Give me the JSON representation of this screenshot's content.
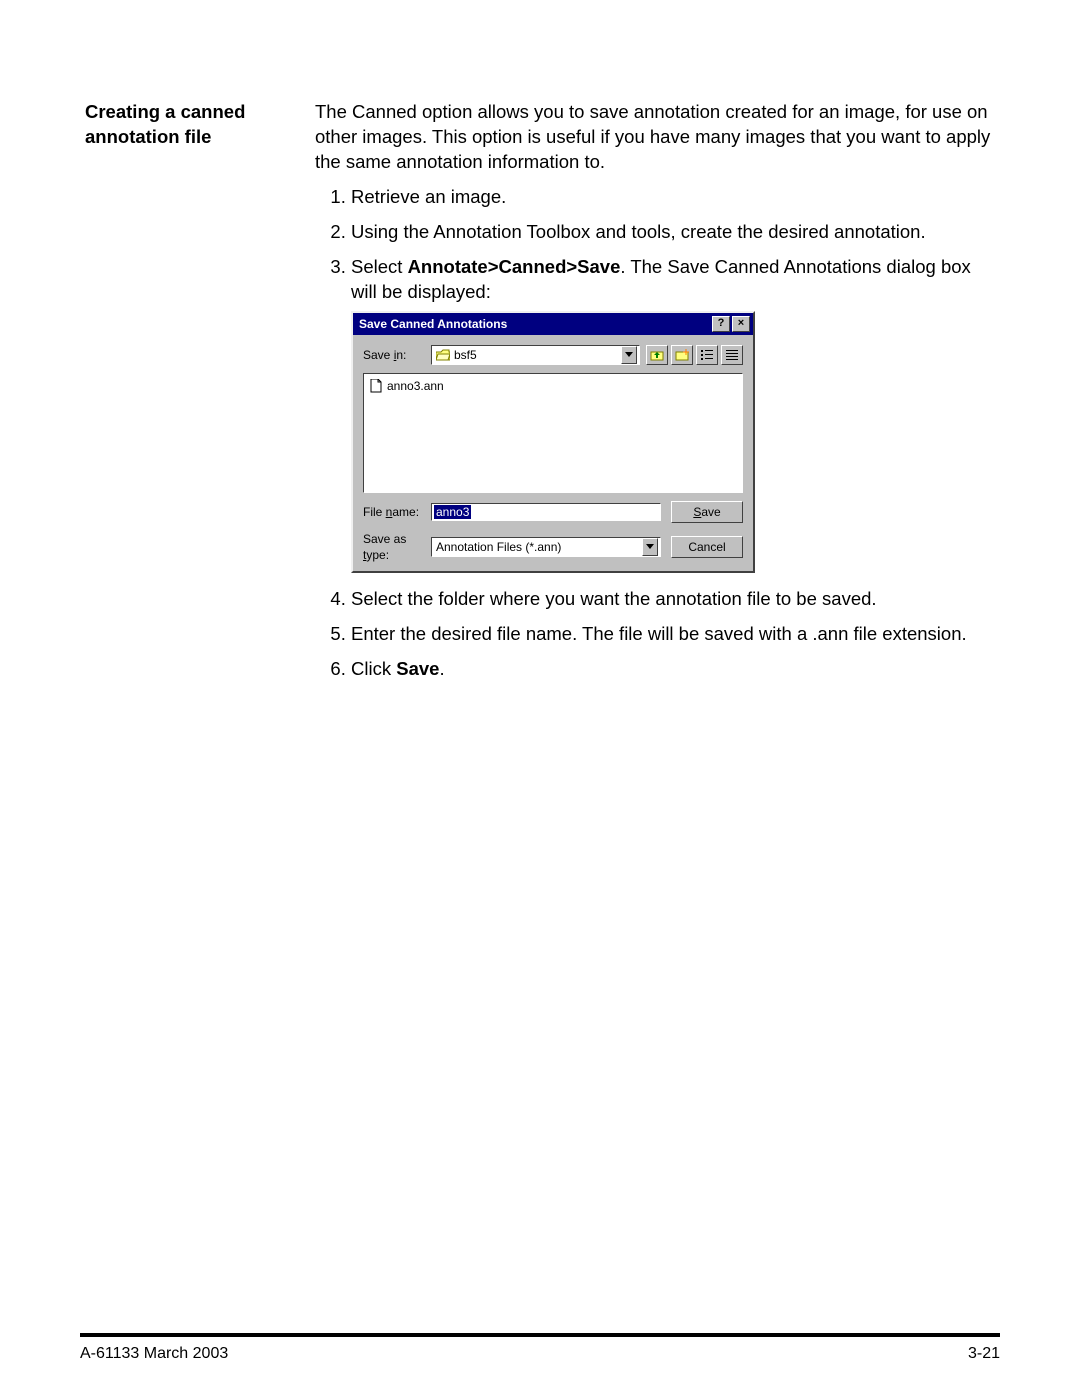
{
  "heading": "Creating a canned annotation file",
  "intro": "The Canned option allows you to save annotation created for an image, for use on other images. This option is useful if you have many images that you want to apply the same annotation information to.",
  "steps": {
    "s1": "Retrieve an image.",
    "s2": "Using the Annotation Toolbox and tools, create the desired annotation.",
    "s3_a": "Select ",
    "s3_b": "Annotate>Canned>Save",
    "s3_c": ".  The Save Canned Annotations dialog box will be displayed:",
    "s4": "Select the folder where you want the annotation file to be saved.",
    "s5": "Enter the desired file name.  The file will be saved with a .ann file extension.",
    "s6_a": "Click ",
    "s6_b": "Save",
    "s6_c": "."
  },
  "dialog": {
    "title": "Save Canned Annotations",
    "help_btn": "?",
    "close_btn": "×",
    "savein_label_pre": "Save ",
    "savein_label_u": "i",
    "savein_label_post": "n:",
    "savein_value": "bsf5",
    "file_list_item": "anno3.ann",
    "filename_label_pre": "File ",
    "filename_label_u": "n",
    "filename_label_post": "ame:",
    "filename_value": "anno3",
    "filetype_label_pre": "Save as ",
    "filetype_label_u": "t",
    "filetype_label_post": "ype:",
    "filetype_value": "Annotation Files (*.ann)",
    "save_btn_u": "S",
    "save_btn_rest": "ave",
    "cancel_btn": "Cancel"
  },
  "footer": {
    "left": "A-61133  March 2003",
    "right": "3-21"
  }
}
